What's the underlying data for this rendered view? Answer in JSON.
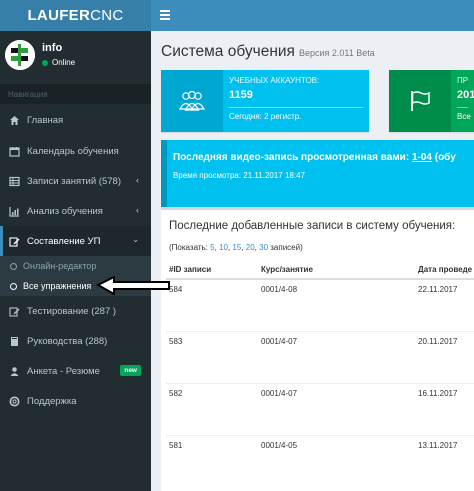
{
  "brand": {
    "bold": "LAUFER",
    "thin": "CNC"
  },
  "user": {
    "name": "info",
    "status": "Online"
  },
  "sidebar": {
    "header": "Навигация",
    "items": [
      {
        "label": "Главная",
        "icon": "home-icon"
      },
      {
        "label": "Календарь обучения",
        "icon": "calendar-icon"
      },
      {
        "label": "Записи занятий (578)",
        "icon": "table-icon"
      },
      {
        "label": "Анализ обучения",
        "icon": "chart-icon"
      },
      {
        "label": "Составление УП",
        "icon": "edit-icon"
      }
    ],
    "submenu": [
      {
        "label": "Онлайн-редактор"
      },
      {
        "label": "Все упражнения"
      }
    ],
    "items_after": [
      {
        "label": "Тестирование (287 )",
        "icon": "edit-icon"
      },
      {
        "label": "Руководства (288)",
        "icon": "book-icon"
      },
      {
        "label": "Анкета - Резюме",
        "icon": "user-icon",
        "badge": "new"
      },
      {
        "label": "Поддержка",
        "icon": "support-icon"
      }
    ]
  },
  "page": {
    "title": "Система обучения",
    "version": "Версия 2.011 Beta"
  },
  "info_boxes": [
    {
      "label": "УЧЕБНЫХ АККАУНТОВ:",
      "number": "1159",
      "desc": "Сегодня: 2 регистр.",
      "color": "#00c0ef"
    },
    {
      "label": "ПР",
      "number": "201",
      "desc": "Все",
      "color": "#00a65a"
    }
  ],
  "callout": {
    "title_prefix": "Последняя видео-запись просмотренная вами:",
    "title_link": "1-04",
    "title_suffix": "(обу",
    "sub": "Время просмотра: 21.11.2017 18:47"
  },
  "records": {
    "title": "Последние добавленные записи в систему обучения:",
    "show_prefix": "(Показать:",
    "show_pages": [
      "5",
      "10",
      "15",
      "20",
      "30"
    ],
    "show_suffix": "записей)",
    "columns": [
      "#ID записи",
      "Курс/занятие",
      "Дата проведе"
    ],
    "rows": [
      [
        "584",
        "0001/4-08",
        "22.11.2017"
      ],
      [
        "583",
        "0001/4-07",
        "20.11.2017"
      ],
      [
        "582",
        "0001/4-07",
        "16.11.2017"
      ],
      [
        "581",
        "0001/4-05",
        "13.11.2017"
      ]
    ]
  }
}
